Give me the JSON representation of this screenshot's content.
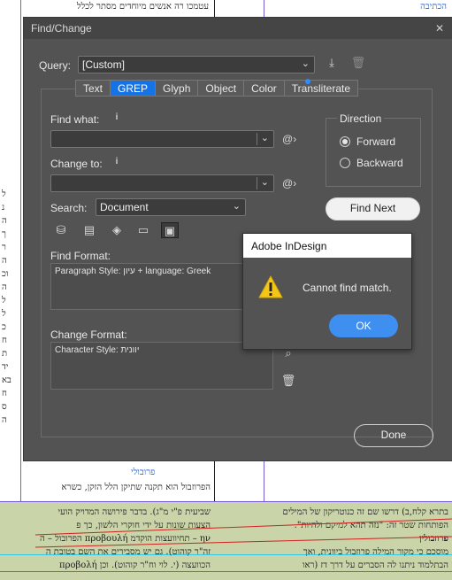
{
  "document": {
    "lines_top": [
      "הכתיבה",
      "עטמכו רה אנשים מיוחדים מסתר לכלל",
      "זיכולם"
    ],
    "lines_left": [
      "ל",
      "נ",
      "ה",
      "ך",
      "ר",
      "ה",
      "וכ",
      "ה",
      "ל",
      "ל",
      "כ",
      "ח",
      "ת",
      "יד",
      "בא",
      "ח",
      "ס",
      "ה"
    ],
    "lines_bottom_left": [
      "פרובולי",
      "הפרוזבול הוא תקנה שתיקן הלל הזקן, כשרא",
      "שביעית פ\"י מ\"ג). בדבר פירושה המדויק הועי",
      "הצעות שונות על ידי חוקרי הלשון, כך פ",
      "ην – תחיוועצות הוקדמ προβουλή הפרובול – ה",
      "זה\"ר קוהוט). גם יש מסבירים את השם בטובת ה",
      "הכוועצה (י. לוי וח\"ר קוהוט). וכן προβολή"
    ],
    "lines_bottom_right": [
      "בתרא קלח,ב) דרשו שם זה כנוטריקון של המילים",
      "הפותחות שטר זה: \"נזה תהא למיקם ולהיות\".",
      "פרוזבולין",
      "מוסכם כי מקור המילה פרוזבול ביוונית, ואך",
      "הבתלמוד ניתנו לה הסברים על דרך דז (ראו"
    ]
  },
  "find_change": {
    "title": "Find/Change",
    "query_label": "Query:",
    "query_value": "[Custom]",
    "tabs": [
      "Text",
      "GREP",
      "Glyph",
      "Object",
      "Color",
      "Transliterate"
    ],
    "selected_tab": "GREP",
    "find_what_label": "Find what:",
    "find_what_value": "",
    "change_to_label": "Change to:",
    "change_to_value": "",
    "search_label": "Search:",
    "search_value": "Document",
    "find_format_label": "Find Format:",
    "find_format_value": "Paragraph Style: עיון + language: Greek",
    "change_format_label": "Change Format:",
    "change_format_value": "Character Style: יוונית",
    "direction_label": "Direction",
    "forward_label": "Forward",
    "backward_label": "Backward",
    "direction_selected": "Forward",
    "find_next_label": "Find Next",
    "done_label": "Done",
    "special_char_symbol": "@",
    "info_symbol": "i",
    "colors": {
      "panel": "#535353",
      "accent": "#1473e6",
      "title_bar": "#454545"
    },
    "icons": [
      "save-query-icon",
      "delete-query-icon",
      "include-locked-layers-icon",
      "include-locked-stories-icon",
      "include-hidden-layers-icon",
      "include-master-pages-icon",
      "include-footnotes-icon",
      "find-format-search-icon",
      "clear-format-icon"
    ]
  },
  "alert": {
    "title": "Adobe InDesign",
    "message": "Cannot find match.",
    "ok_label": "OK",
    "colors": {
      "ok_button": "#3e8ff0",
      "warning": "#f5c518"
    }
  }
}
